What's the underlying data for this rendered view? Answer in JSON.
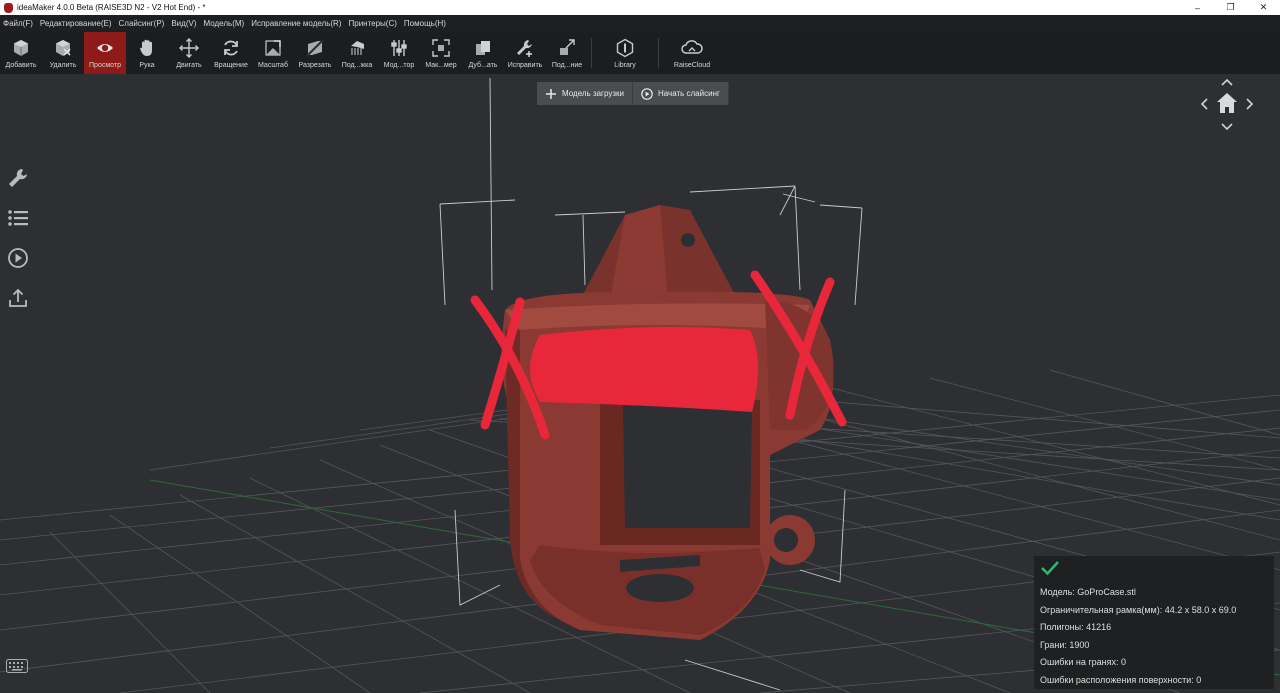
{
  "window": {
    "title": "ideaMaker 4.0.0 Beta (RAISE3D N2 - V2 Hot End) - *",
    "controls": [
      "–",
      "❐",
      "✕"
    ]
  },
  "menu": [
    "Файл(F)",
    "Редактирование(E)",
    "Слайсинг(P)",
    "Вид(V)",
    "Модель(M)",
    "Исправление модель(R)",
    "Принтеры(C)",
    "Помощь(H)"
  ],
  "toolbar": {
    "add": "Добавить",
    "delete": "Удалить",
    "view": "Просмотр",
    "hand": "Рука",
    "move": "Двигать",
    "rotate": "Вращение",
    "scale": "Масштаб",
    "cut": "Разрезать",
    "support": "Под...жка",
    "modifier": "Мод...тор",
    "max_size": "Мак...мер",
    "duplicate": "Дуб...ать",
    "repair": "Исправить",
    "connect": "Под...ние",
    "library": "Library",
    "raisecloud": "RaiseCloud"
  },
  "actions": {
    "load_model": "Модель загрузки",
    "start_slicing": "Начать слайсинг"
  },
  "info": {
    "model": "Модель: GoProCase.stl",
    "bounding_box": "Ограничительная рамка(мм): 44.2 x 58.0 x 69.0",
    "polygons": "Полигоны: 41216",
    "faces": "Грани: 1900",
    "face_errors": "Ошибки на гранях: 0",
    "surface_errors": "Ошибки расположения поверхности: 0"
  },
  "colors": {
    "accent": "#8f1a1a",
    "model": "#8a3a32",
    "check": "#2fbf71",
    "scribble": "#e8283a"
  }
}
